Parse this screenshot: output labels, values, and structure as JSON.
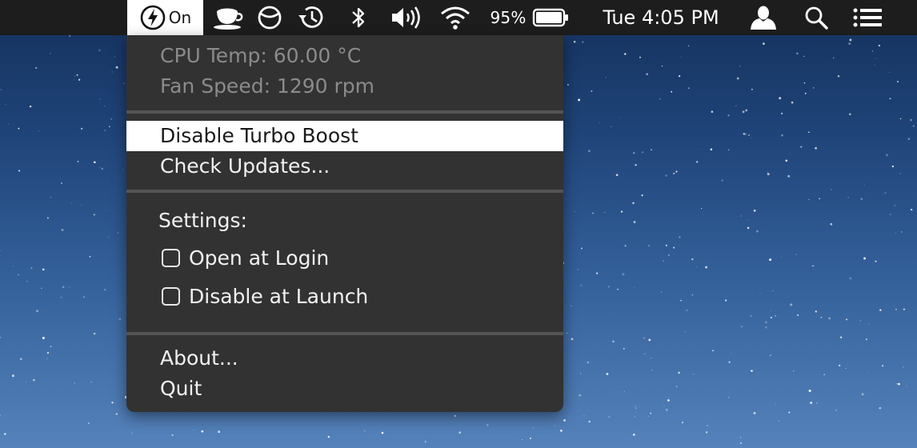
{
  "menubar": {
    "app_status": "On",
    "battery_percent": "95%",
    "clock": "Tue 4:05 PM",
    "icons": [
      "turbo-boost-icon",
      "coffee-cup-icon",
      "no-sleep-icon",
      "time-machine-icon",
      "bluetooth-icon",
      "volume-icon",
      "wifi-icon",
      "battery-icon",
      "user-icon",
      "spotlight-icon",
      "notification-center-icon"
    ]
  },
  "menu": {
    "cpu_temp": "CPU Temp: 60.00 °C",
    "fan_speed": "Fan Speed: 1290 rpm",
    "disable_turbo": "Disable Turbo Boost",
    "check_updates": "Check Updates...",
    "settings_header": "Settings:",
    "open_at_login": "Open at Login",
    "open_at_login_checked": false,
    "disable_at_launch": "Disable at Launch",
    "disable_at_launch_checked": false,
    "about": "About...",
    "quit": "Quit"
  },
  "colors": {
    "menubar_bg": "#1d1d1d",
    "menu_bg": "#323232",
    "highlight_bg": "#ffffff",
    "disabled_text": "#8b8b8b",
    "desktop_top": "#14305b",
    "desktop_bottom": "#5582bb"
  }
}
